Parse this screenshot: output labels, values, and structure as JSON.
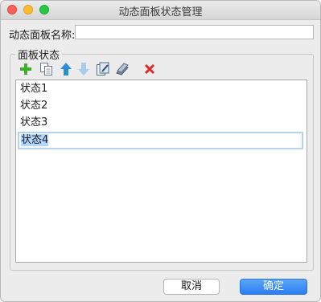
{
  "window": {
    "title": "动态面板状态管理"
  },
  "name_field": {
    "label": "动态面板名称:",
    "value": ""
  },
  "group": {
    "legend": "面板状态"
  },
  "toolbar": {
    "items": [
      {
        "icon": "add-icon",
        "color": "#3fae2a"
      },
      {
        "icon": "duplicate-icon",
        "color": "#6b7a8c"
      },
      {
        "icon": "move-up-icon",
        "color": "#2c8fd6"
      },
      {
        "icon": "move-down-icon",
        "color": "#a9cde8"
      },
      {
        "icon": "edit-state-icon",
        "color": "#4f6b8a"
      },
      {
        "icon": "edit-all-icon",
        "color": "#5d6f85"
      },
      {
        "icon": "delete-icon",
        "color": "#e02a2a"
      }
    ]
  },
  "states": [
    "状态1",
    "状态2",
    "状态3",
    "状态4"
  ],
  "editing_index": 3,
  "buttons": {
    "cancel": "取消",
    "ok": "确定"
  }
}
